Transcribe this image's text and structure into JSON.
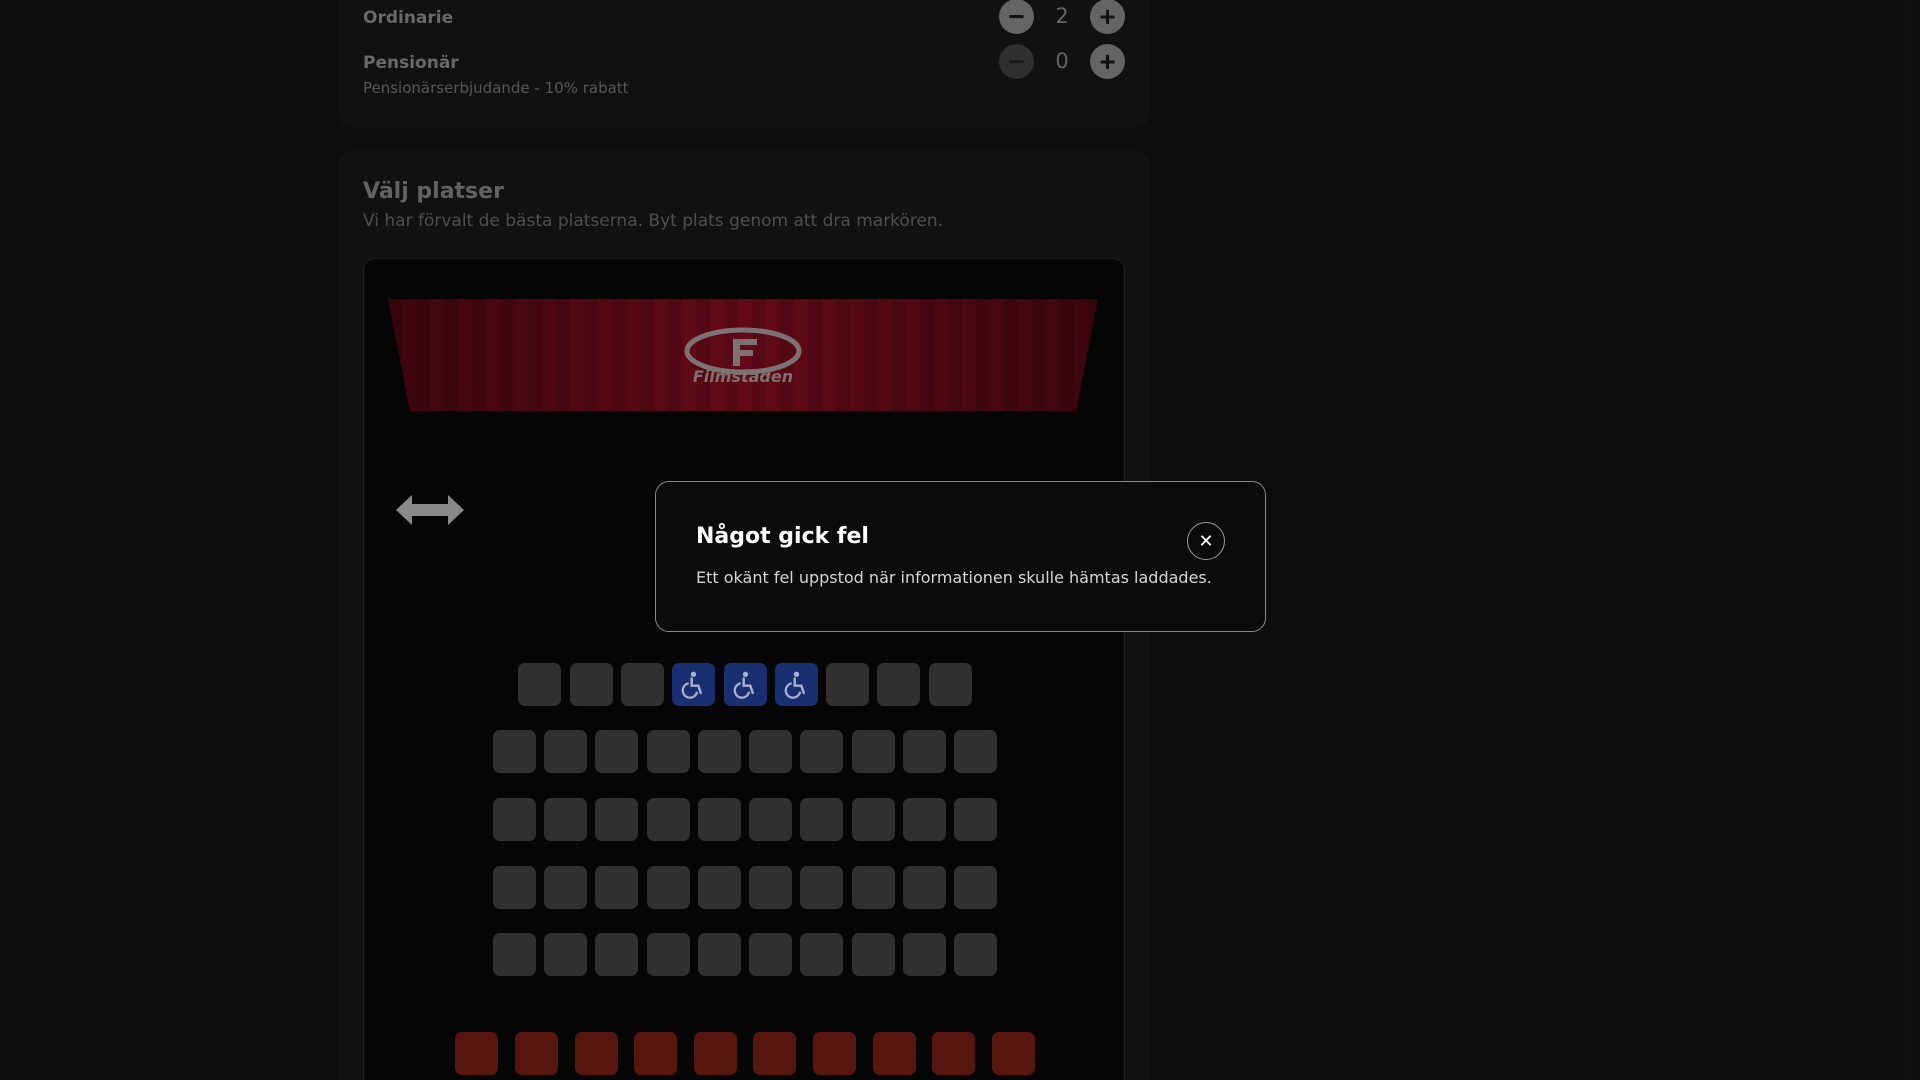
{
  "tickets": [
    {
      "name": "Ordinarie",
      "description": "",
      "quantity": "2",
      "minus": "−",
      "plus": "+"
    },
    {
      "name": "Pensionär",
      "description": "Pensionärserbjudande - 10% rabatt",
      "quantity": "0",
      "minus": "−",
      "plus": "+"
    }
  ],
  "seat_selection": {
    "title": "Välj platser",
    "subtitle": "Vi har förvalt de bästa platserna. Byt plats genom att dra markören.",
    "screen_logo_text": "Filmstaden",
    "rows": [
      {
        "seats": [
          "standard",
          "standard",
          "standard",
          "wheelchair",
          "wheelchair",
          "wheelchair",
          "standard",
          "standard",
          "standard"
        ]
      },
      {
        "seats": [
          "standard",
          "standard",
          "standard",
          "standard",
          "standard",
          "standard",
          "standard",
          "standard",
          "standard",
          "standard"
        ]
      },
      {
        "seats": [
          "standard",
          "standard",
          "standard",
          "standard",
          "standard",
          "standard",
          "standard",
          "standard",
          "standard",
          "standard"
        ]
      },
      {
        "seats": [
          "standard",
          "standard",
          "standard",
          "standard",
          "standard",
          "standard",
          "standard",
          "standard",
          "standard",
          "standard"
        ]
      },
      {
        "seats": [
          "standard",
          "standard",
          "standard",
          "standard",
          "standard",
          "standard",
          "standard",
          "standard",
          "standard",
          "standard"
        ]
      },
      {
        "seats": [
          "premium",
          "premium",
          "premium",
          "premium",
          "premium",
          "premium",
          "premium",
          "premium",
          "premium",
          "premium"
        ]
      }
    ],
    "icons": {
      "resize": "resize-horizontal-icon",
      "wheelchair": "wheelchair-icon"
    }
  },
  "dialog": {
    "title": "Något gick fel",
    "message": "Ett okänt fel uppstod när informationen skulle hämtas laddades.",
    "close_label": "✕"
  },
  "colors": {
    "background": "#0f0f0f",
    "card": "#151515",
    "seat_standard": "#3b3b3b",
    "seat_wheelchair": "#1f3a8a",
    "seat_premium": "#6a1a10",
    "screen": "#8a0e22"
  }
}
